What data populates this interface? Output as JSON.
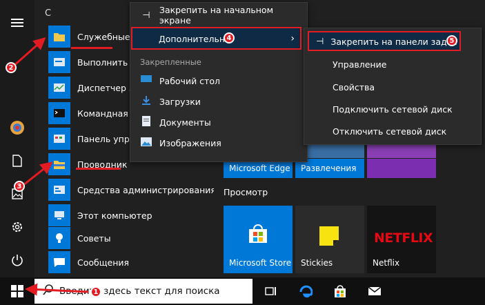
{
  "start_menu": {
    "section_letter": "С",
    "apps": [
      {
        "label": "Служебные — Windows",
        "icon": "folder-icon"
      },
      {
        "label": "Выполнить",
        "icon": "run-icon"
      },
      {
        "label": "Диспетчер задач",
        "icon": "task-manager-icon"
      },
      {
        "label": "Командная строка",
        "icon": "cmd-icon"
      },
      {
        "label": "Панель управления",
        "icon": "control-panel-icon"
      },
      {
        "label": "Проводник",
        "icon": "explorer-icon"
      },
      {
        "label": "Средства администрирования Windows",
        "icon": "admin-tools-icon"
      },
      {
        "label": "Этот компьютер",
        "icon": "computer-icon"
      },
      {
        "label": "Советы",
        "icon": "tips-icon"
      },
      {
        "label": "Сообщения",
        "icon": "messages-icon"
      }
    ]
  },
  "context_menu": {
    "pin_start": "Закрепить на начальном экране",
    "more": "Дополнительно",
    "pinned_section": "Закрепленные",
    "pinned_items": [
      "Рабочий стол",
      "Загрузки",
      "Документы",
      "Изображения"
    ]
  },
  "submenu": {
    "items": [
      "Закрепить на панели задач",
      "Управление",
      "Свойства",
      "Подключить сетевой диск",
      "Отключить сетевой диск"
    ]
  },
  "tiles": {
    "edge": "Microsoft Edge",
    "entertainment": "Развлечения",
    "browse_heading": "Просмотр",
    "store": "Microsoft Store",
    "stickies": "Stickies",
    "netflix": "Netflix",
    "netflix_logo": "NETFLIX"
  },
  "taskbar": {
    "search_placeholder": "Введите здесь текст для поиска"
  },
  "annotations": [
    "1",
    "2",
    "3",
    "4",
    "5"
  ],
  "colors": {
    "accent": "#0078d7",
    "highlight": "#e31b23"
  }
}
